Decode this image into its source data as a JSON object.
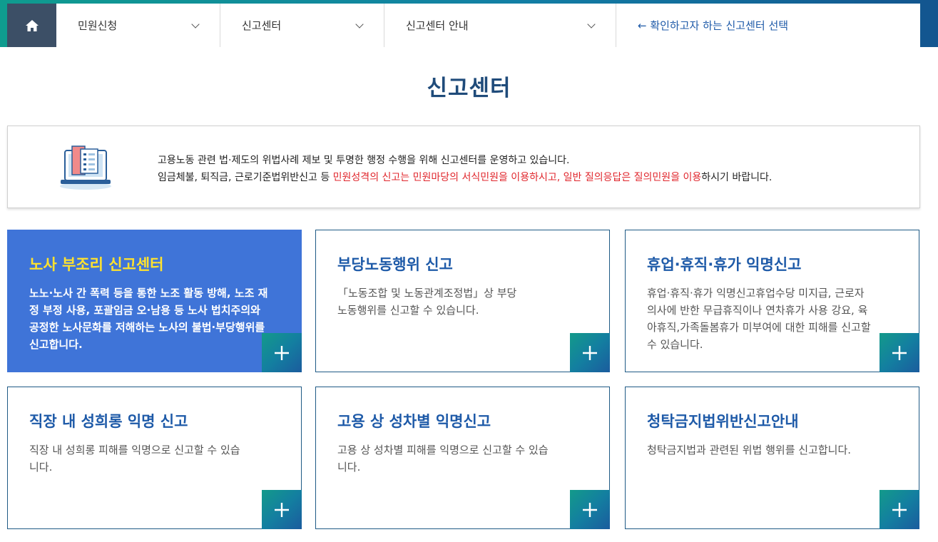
{
  "nav": {
    "home_icon": "home-icon",
    "items": [
      {
        "label": "민원신청"
      },
      {
        "label": "신고센터"
      },
      {
        "label": "신고센터 안내"
      }
    ],
    "hint": "← 확인하고자 하는 신고센터 선택"
  },
  "page_title": "신고센터",
  "info": {
    "icon": "laptop-document-icon",
    "line1": "고용노동 관련 법·제도의 위법사례 제보 및 투명한 행정 수행을 위해 신고센터를 운영하고 있습니다.",
    "line2_prefix": "임금체불, 퇴직금, 근로기준법위반신고 등 ",
    "line2_highlight": "민원성격의 신고는 민원마당의 서식민원을 이용하시고, 일반 질의응답은 질의민원을 이용",
    "line2_suffix": "하시기 바랍니다."
  },
  "colors": {
    "title": "#1f4b7a",
    "accent_blue": "#1e5aa8",
    "featured_bg": "#3f74d8",
    "featured_title": "#ffe22e",
    "highlight_red": "#e0262c"
  },
  "cards": [
    {
      "title": "노사 부조리 신고센터",
      "desc": "노노·노사 간 폭력 등을 통한 노조 활동 방해, 노조 재정 부정 사용, 포괄임금 오·남용 등 노사 법치주의와 공정한 노사문화를 저해하는 노사의 불법·부당행위를 신고합니다.",
      "featured": true
    },
    {
      "title": "부당노동행위 신고",
      "desc": "「노동조합 및 노동관계조정법」상 부당노동행위를 신고할 수 있습니다."
    },
    {
      "title": "휴업·휴직·휴가 익명신고",
      "desc": "휴업·휴직·휴가 익명신고휴업수당 미지급, 근로자 의사에 반한 무급휴직이나 연차휴가 사용 강요, 육아휴직,가족돌봄휴가 미부여에 대한 피해를 신고할 수 있습니다."
    },
    {
      "title": "직장 내 성희롱 익명 신고",
      "desc": "직장 내 성희롱 피해를 익명으로 신고할 수 있습니다."
    },
    {
      "title": "고용 상 성차별 익명신고",
      "desc": "고용 상 성차별 피해를 익명으로 신고할 수 있습니다."
    },
    {
      "title": "청탁금지법위반신고안내",
      "desc": "청탁금지법과 관련된 위법 행위를 신고합니다."
    }
  ],
  "plus_icon": "plus-icon"
}
